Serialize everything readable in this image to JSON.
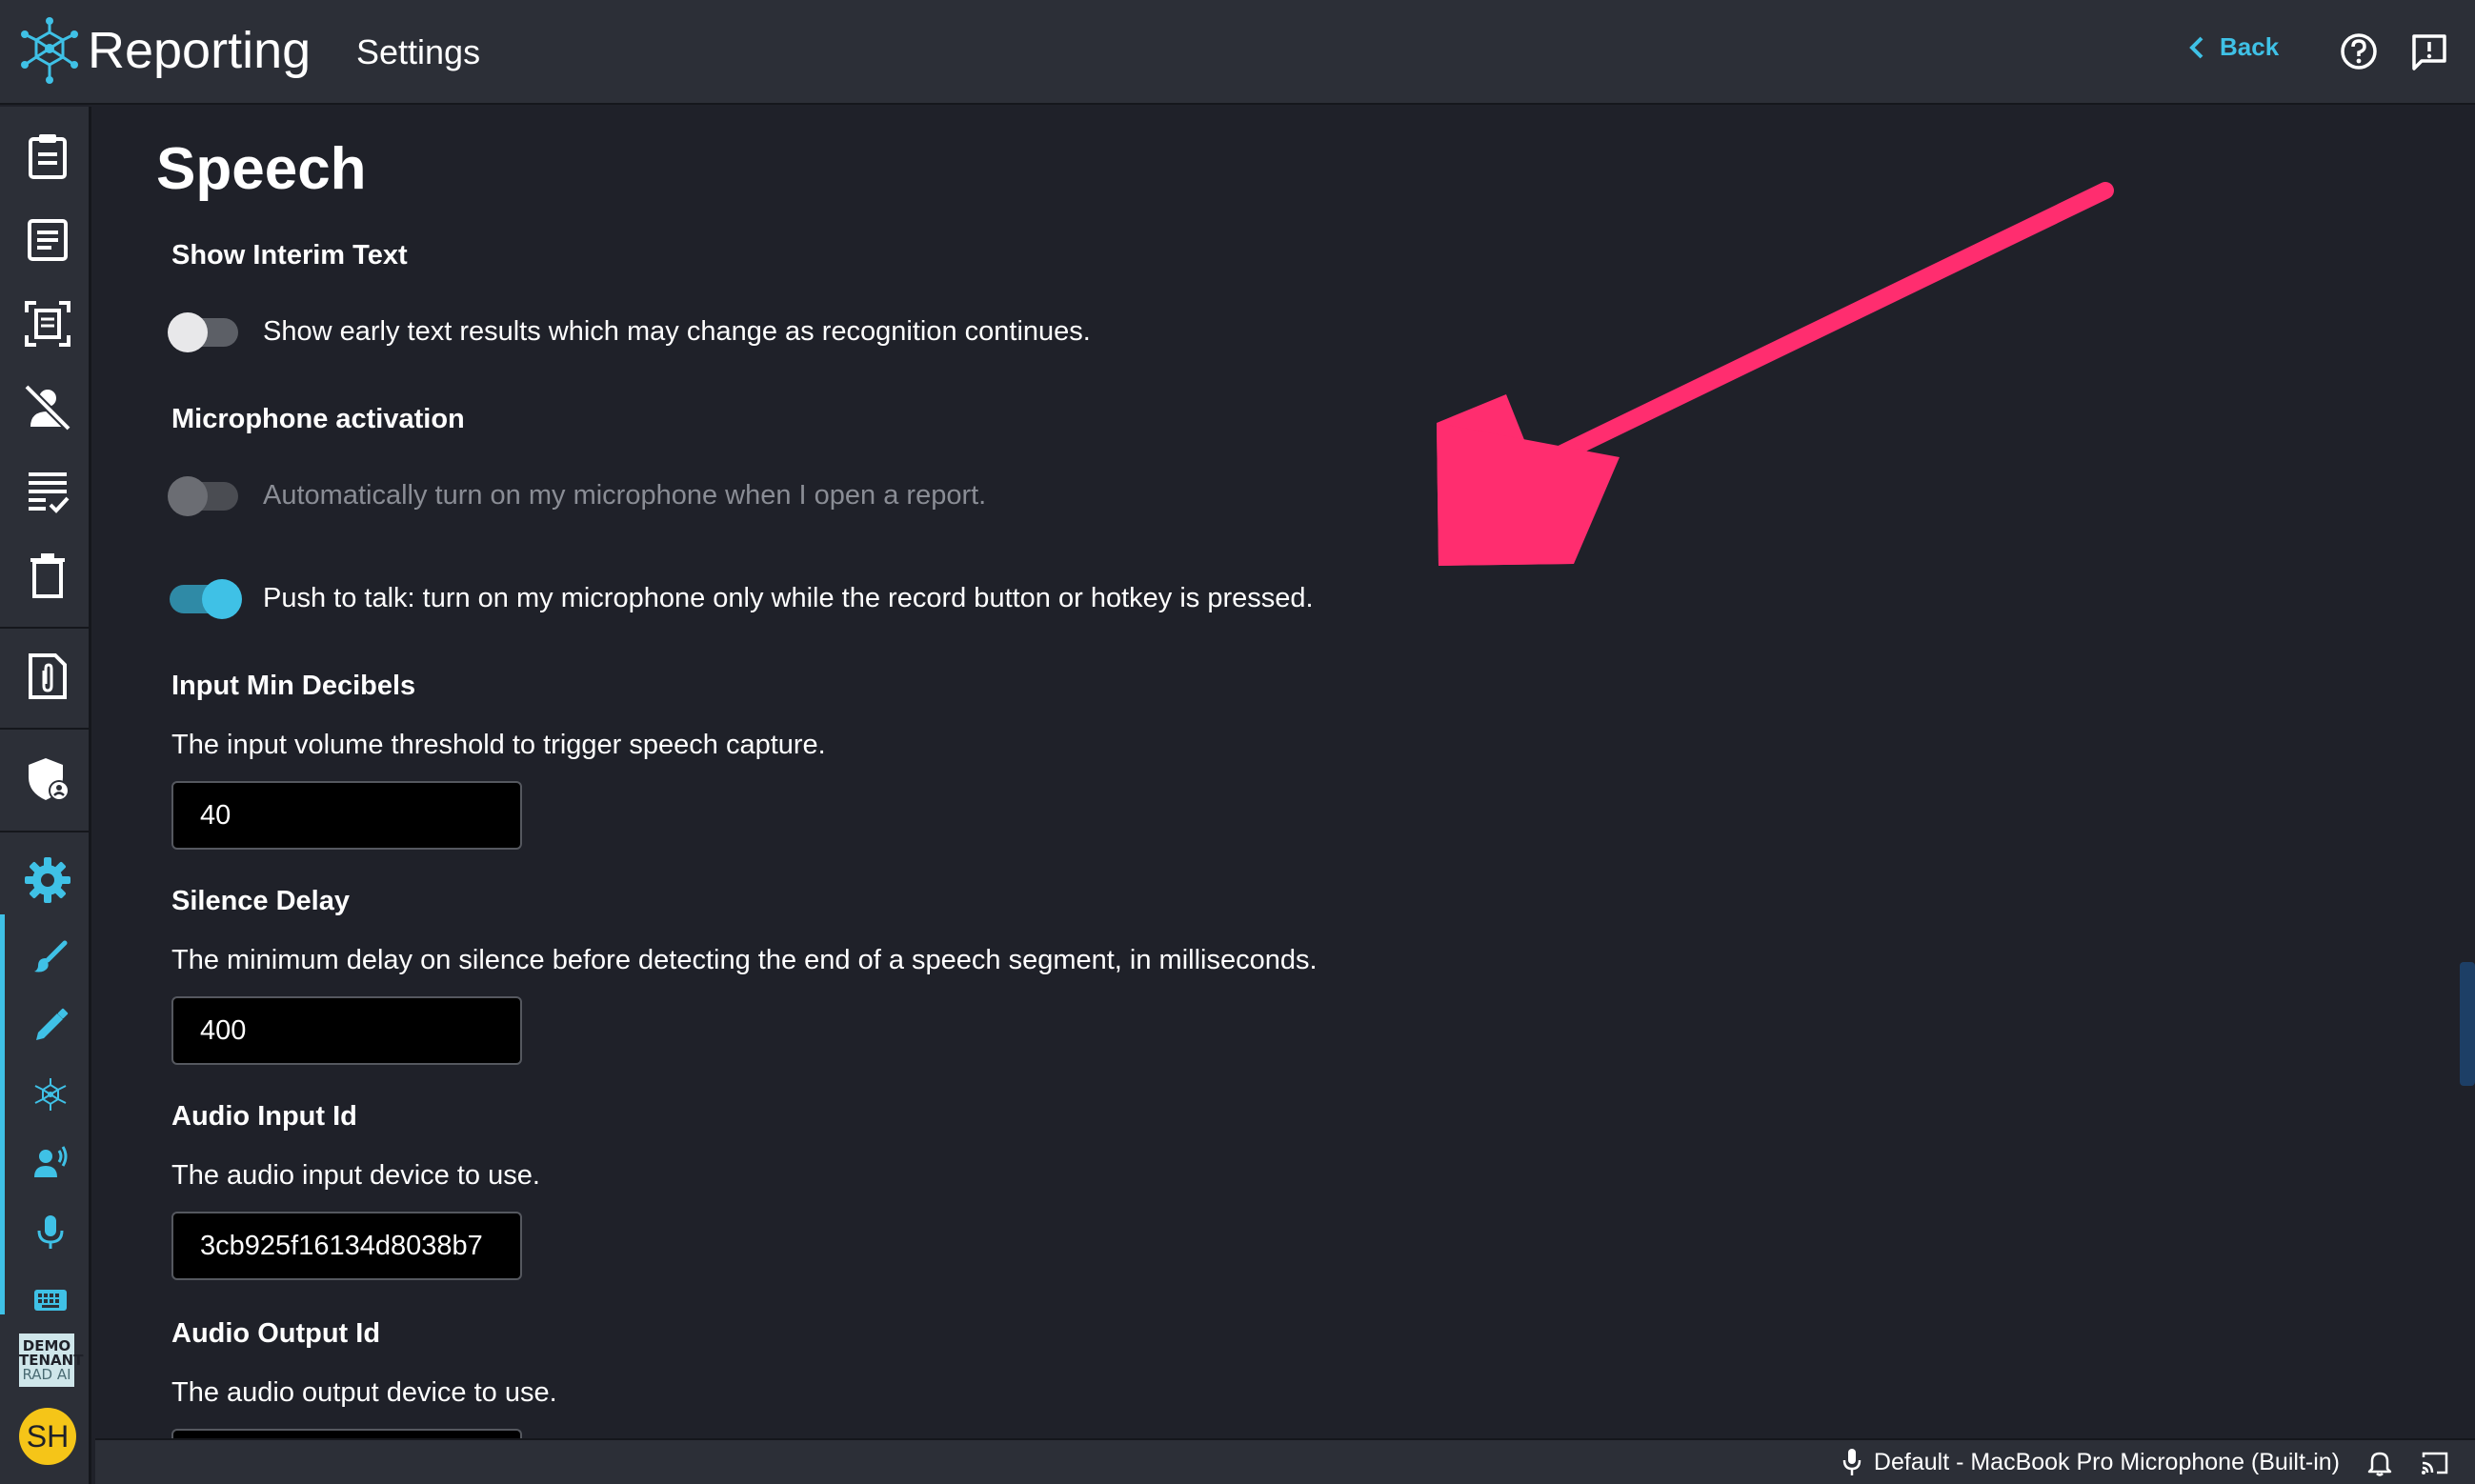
{
  "header": {
    "app_title": "Reporting",
    "section_title": "Settings",
    "back_label": "Back"
  },
  "sidebar": {
    "items": [
      {
        "icon": "clipboard-icon"
      },
      {
        "icon": "document-list-icon"
      },
      {
        "icon": "scan-document-icon"
      },
      {
        "icon": "user-off-icon"
      },
      {
        "icon": "checklist-icon"
      },
      {
        "icon": "trash-icon"
      },
      {
        "icon": "attachment-document-icon"
      },
      {
        "icon": "shield-user-icon"
      },
      {
        "icon": "gear-icon"
      },
      {
        "icon": "brush-icon"
      },
      {
        "icon": "pencil-icon"
      },
      {
        "icon": "network-logo-icon"
      },
      {
        "icon": "voice-user-icon"
      },
      {
        "icon": "microphone-icon"
      },
      {
        "icon": "keyboard-icon"
      }
    ],
    "tenant_badge": {
      "line1": "DEMO",
      "line2": "TENANT",
      "line3": "RAD AI"
    },
    "avatar_initials": "SH"
  },
  "page": {
    "title": "Speech",
    "interim": {
      "label": "Show Interim Text",
      "toggle_text": "Show early text results which may change as recognition continues.",
      "enabled": false
    },
    "mic_activation": {
      "label": "Microphone activation",
      "auto_text": "Automatically turn on my microphone when I open a report.",
      "auto_enabled": false,
      "ptt_text": "Push to talk: turn on my microphone only while the record button or hotkey is pressed.",
      "ptt_enabled": true
    },
    "min_decibels": {
      "label": "Input Min Decibels",
      "desc": "The input volume threshold to trigger speech capture.",
      "value": "40"
    },
    "silence_delay": {
      "label": "Silence Delay",
      "desc": "The minimum delay on silence before detecting the end of a speech segment, in milliseconds.",
      "value": "400"
    },
    "audio_input": {
      "label": "Audio Input Id",
      "desc": "The audio input device to use.",
      "value": "3cb925f16134d8038b7"
    },
    "audio_output": {
      "label": "Audio Output Id",
      "desc": "The audio output device to use."
    }
  },
  "statusbar": {
    "mic_device": "Default - MacBook Pro Microphone (Built-in)"
  },
  "colors": {
    "accent": "#3fc1e6",
    "background": "#1f2129",
    "bar": "#2c2f37",
    "annotation": "#ff2d6f"
  }
}
